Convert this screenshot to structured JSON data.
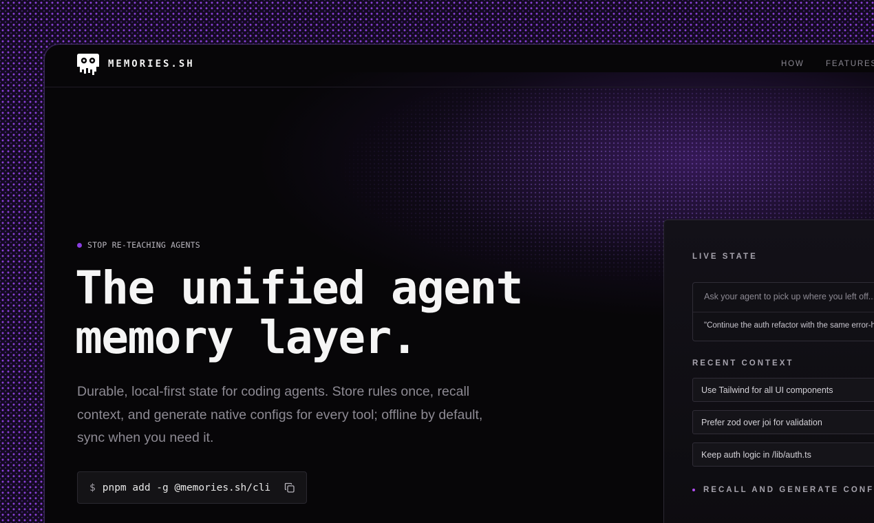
{
  "brand": {
    "name": "MEMORIES.SH",
    "logo_icon": "skull-icon"
  },
  "nav": {
    "links": [
      "HOW",
      "FEATURES"
    ]
  },
  "hero": {
    "badge": "STOP RE-TEACHING AGENTS",
    "title_line1": "The unified agent",
    "title_line2": "memory layer.",
    "description": "Durable, local-first state for coding agents. Store rules once, recall context, and generate native configs for every tool; offline by default, sync when you need it.",
    "command_prompt": "$",
    "command": "pnpm add -g @memories.sh/cli",
    "copy_icon": "copy-icon"
  },
  "panel": {
    "live_state_title": "LIVE STATE",
    "ask_placeholder": "Ask your agent to pick up where you left off...",
    "ask_response": "\"Continue the auth refactor with the same error-ha",
    "recent_context_title": "RECENT CONTEXT",
    "recent_items": [
      "Use Tailwind for all UI components",
      "Prefer zod over joi for validation",
      "Keep auth logic in /lib/auth.ts"
    ],
    "recall_label": "RECALL AND GENERATE CONFIG"
  },
  "colors": {
    "accent": "#8a3ee0",
    "background": "#070608",
    "pattern": "#9646eb"
  }
}
